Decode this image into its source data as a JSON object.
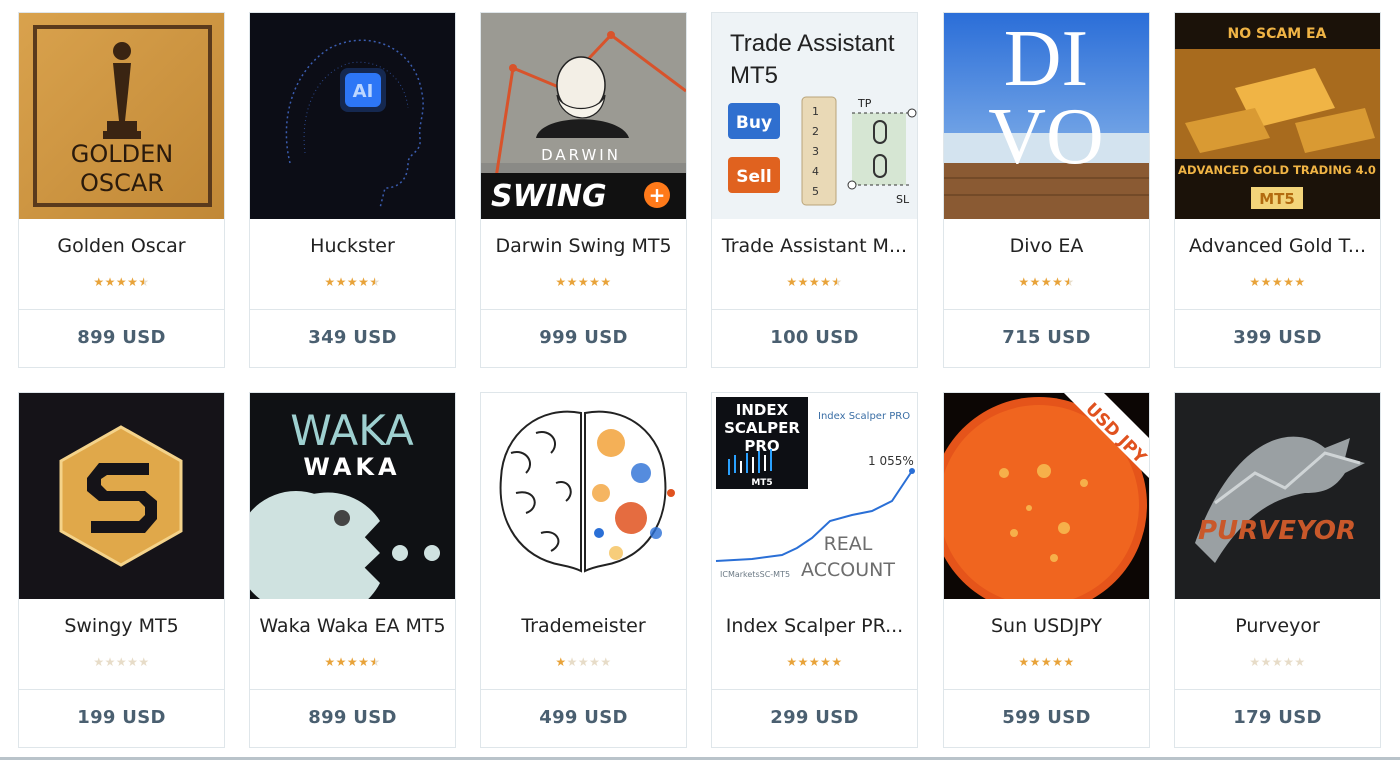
{
  "products": [
    {
      "title": "Golden Oscar",
      "price": "899 USD",
      "rating": 4.5,
      "image": "golden-oscar-image",
      "image_text": [
        "GOLDEN",
        "OSCAR"
      ]
    },
    {
      "title": "Huckster",
      "price": "349 USD",
      "rating": 4.5,
      "image": "ai-head-image",
      "image_text": [
        "AI"
      ]
    },
    {
      "title": "Darwin Swing MT5",
      "price": "999 USD",
      "rating": 5,
      "image": "darwin-swing-image",
      "image_text": [
        "DARWIN",
        "SWING",
        "+"
      ]
    },
    {
      "title": "Trade Assistant M...",
      "price": "100 USD",
      "rating": 4.5,
      "image": "trade-assistant-image",
      "image_text": [
        "Trade Assistant",
        "MT5",
        "Buy",
        "Sell",
        "TP",
        "SL",
        "1",
        "2",
        "3",
        "4",
        "5"
      ]
    },
    {
      "title": "Divo EA",
      "price": "715 USD",
      "rating": 4.5,
      "image": "divo-image",
      "image_text": [
        "DI",
        "VO"
      ]
    },
    {
      "title": "Advanced Gold T...",
      "price": "399 USD",
      "rating": 5,
      "image": "gold-bars-image",
      "image_text": [
        "NO SCAM EA",
        "ADVANCED GOLD TRADING 4.0",
        "MT5"
      ]
    },
    {
      "title": "Swingy MT5",
      "price": "199 USD",
      "rating": 0,
      "image": "swingy-s-logo-image",
      "image_text": []
    },
    {
      "title": "Waka Waka EA MT5",
      "price": "899 USD",
      "rating": 4.5,
      "image": "waka-waka-pacman-image",
      "image_text": [
        "WAKA",
        "WAKA"
      ]
    },
    {
      "title": "Trademeister",
      "price": "499 USD",
      "rating": 1,
      "image": "brain-image",
      "image_text": []
    },
    {
      "title": "Index Scalper PR...",
      "price": "299 USD",
      "rating": 5,
      "image": "index-scalper-image",
      "image_text": [
        "INDEX",
        "SCALPER",
        "PRO",
        "MT5",
        "Index Scalper PRO",
        "1 055%",
        "REAL",
        "ACCOUNT",
        "ICMarketsSC-MT5"
      ]
    },
    {
      "title": "Sun USDJPY",
      "price": "599 USD",
      "rating": 5,
      "image": "sun-image",
      "image_text": [
        "USD JPY"
      ]
    },
    {
      "title": "Purveyor",
      "price": "179 USD",
      "rating": 0,
      "image": "purveyor-bull-image",
      "image_text": [
        "PURVEYOR"
      ]
    }
  ],
  "colors": {
    "star_full": "#e8a33a",
    "star_empty": "#e7dcc8",
    "price": "#4a5f70",
    "border": "#dfe6ea"
  }
}
